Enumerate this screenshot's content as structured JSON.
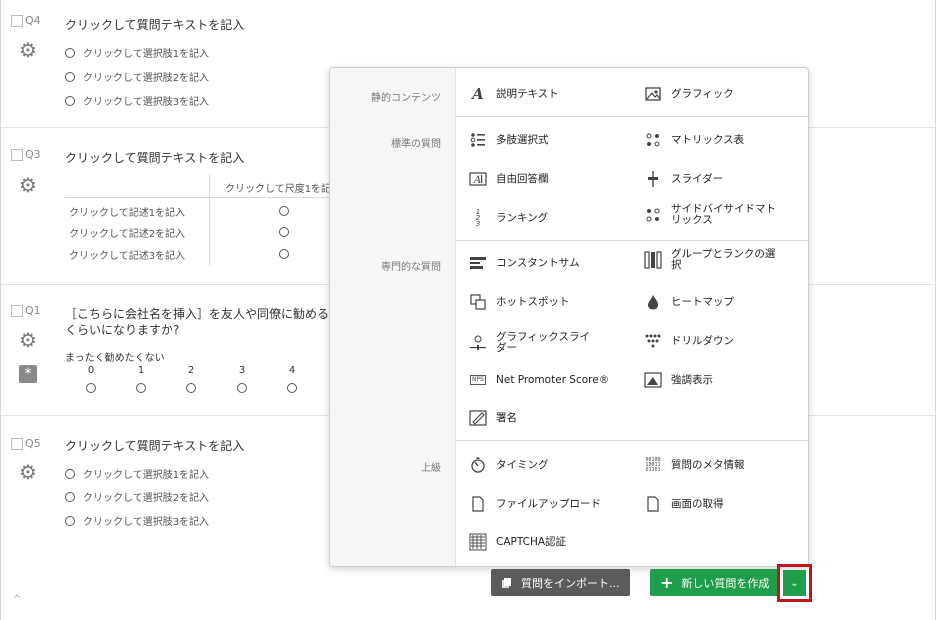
{
  "questions": {
    "q4": {
      "number": "Q4",
      "title": "クリックして質問テキストを記入",
      "choices": [
        "クリックして選択肢1を記入",
        "クリックして選択肢2を記入",
        "クリックして選択肢3を記入"
      ]
    },
    "q3": {
      "number": "Q3",
      "title": "クリックして質問テキストを記入",
      "scale_header": "クリックして尺度1を記",
      "statements": [
        "クリックして記述1を記入",
        "クリックして記述2を記入",
        "クリックして記述3を記入"
      ]
    },
    "q1": {
      "number": "Q1",
      "title_line1": "［こちらに会社名を挿入］を友人や同僚に勧める",
      "title_line2": "くらいになりますか?",
      "left_anchor": "まったく勧めたくない",
      "scale": [
        "0",
        "1",
        "2",
        "3",
        "4"
      ],
      "required_icon": "asterisk-icon"
    },
    "q5": {
      "number": "Q5",
      "title": "クリックして質問テキストを記入",
      "choices": [
        "クリックして選択肢1を記入",
        "クリックして選択肢2を記入",
        "クリックして選択肢3を記入"
      ]
    }
  },
  "menu": {
    "sections": {
      "static": "静的コンテンツ",
      "standard": "標準の質問",
      "specialty": "専門的な質問",
      "advanced": "上級"
    },
    "items": {
      "descriptive_text": "説明テキスト",
      "graphic": "グラフィック",
      "multiple_choice": "多肢選択式",
      "matrix_table": "マトリックス表",
      "text_entry": "自由回答欄",
      "slider": "スライダー",
      "rank_order": "ランキング",
      "side_by_side": "サイドバイサイドマトリックス",
      "constant_sum": "コンスタントサム",
      "pick_group_rank": "グループとランクの選択",
      "hot_spot": "ホットスポット",
      "heat_map": "ヒートマップ",
      "graphic_slider": "グラフィックスライダー",
      "drill_down": "ドリルダウン",
      "nps": "Net Promoter Score®",
      "highlight": "強調表示",
      "signature": "署名",
      "timing": "タイミング",
      "meta_info": "質問のメタ情報",
      "file_upload": "ファイルアップロード",
      "screen_capture": "画面の取得",
      "captcha": "CAPTCHA認証"
    }
  },
  "buttons": {
    "import": "質問をインポート...",
    "new_question": "新しい質問を作成"
  },
  "colors": {
    "primary_green": "#1e9e4a",
    "import_gray": "#5b5b5b",
    "highlight_red": "#c0161c"
  }
}
